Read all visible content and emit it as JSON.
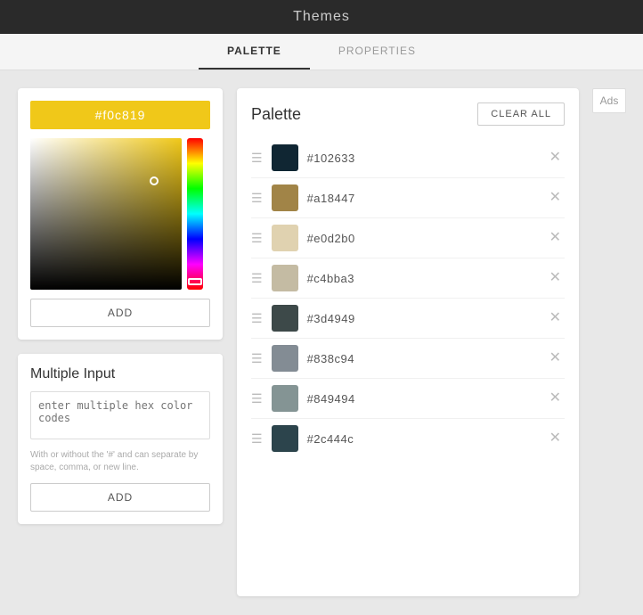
{
  "app": {
    "title": "Themes"
  },
  "tabs": [
    {
      "id": "palette",
      "label": "PALETTE",
      "active": true
    },
    {
      "id": "properties",
      "label": "PROPERTIES",
      "active": false
    }
  ],
  "color_picker": {
    "hex_value": "#f0c819",
    "add_button_label": "ADD"
  },
  "multiple_input": {
    "title": "Multiple Input",
    "textarea_placeholder": "enter multiple hex color codes",
    "hint": "With or without the '#' and can separate by space, comma, or new line.",
    "add_button_label": "ADD"
  },
  "palette": {
    "title": "Palette",
    "clear_all_label": "CLEAR ALL",
    "colors": [
      {
        "hex": "#102633",
        "bg": "#102633"
      },
      {
        "hex": "#a18447",
        "bg": "#a18447"
      },
      {
        "hex": "#e0d2b0",
        "bg": "#e0d2b0"
      },
      {
        "hex": "#c4bba3",
        "bg": "#c4bba3"
      },
      {
        "hex": "#3d4949",
        "bg": "#3d4949"
      },
      {
        "hex": "#838c94",
        "bg": "#838c94"
      },
      {
        "hex": "#849494",
        "bg": "#849494"
      },
      {
        "hex": "#2c444c",
        "bg": "#2c444c"
      }
    ]
  },
  "ads": {
    "label": "Ads"
  }
}
